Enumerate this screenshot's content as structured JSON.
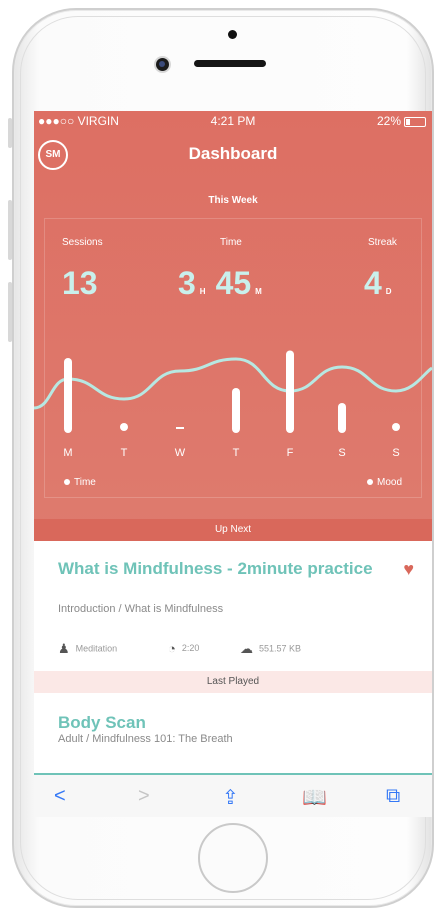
{
  "status_bar": {
    "carrier": "●●●○○ VIRGIN",
    "time": "4:21 PM",
    "battery": "22%"
  },
  "header": {
    "avatar": "SM",
    "title": "Dashboard"
  },
  "week_label": "This Week",
  "stats": [
    {
      "label": "Sessions",
      "value": "13",
      "unit": ""
    },
    {
      "label": "Time",
      "value": "3",
      "unit": "H",
      "value2": "45",
      "unit2": "M"
    },
    {
      "label": "Streak",
      "value": "4",
      "unit": "D"
    }
  ],
  "chart_data": {
    "type": "bar",
    "categories": [
      "M",
      "T",
      "W",
      "T",
      "F",
      "S",
      "S"
    ],
    "series": [
      {
        "name": "Time",
        "values": [
          3,
          0.3,
          0.1,
          1.8,
          3.3,
          1.2,
          0.3
        ]
      },
      {
        "name": "Mood",
        "values": [
          0.6,
          0.1,
          0.8,
          1.1,
          0.3,
          0.9,
          0.3
        ]
      }
    ],
    "legend": [
      "Time",
      "Mood"
    ],
    "grid": false
  },
  "up_next_label": "Up Next",
  "up_next": {
    "title": "What is Mindfulness - 2minute practice",
    "subtitle": "Introduction / What is Mindfulness",
    "type": "Meditation",
    "duration": "2:20",
    "size": "551.57 KB"
  },
  "last_played_label": "Last Played",
  "last_played": {
    "title": "Body Scan",
    "subtitle": "Adult / Mindfulness 101: The Breath"
  },
  "toolbar": {
    "back": "<",
    "forward": ">",
    "share": "⇪",
    "bookmarks": "📖",
    "tabs": "⧉"
  },
  "colors": {
    "accent": "#dd6f63",
    "teal": "#6fc3b8",
    "heart": "#d9685b"
  }
}
